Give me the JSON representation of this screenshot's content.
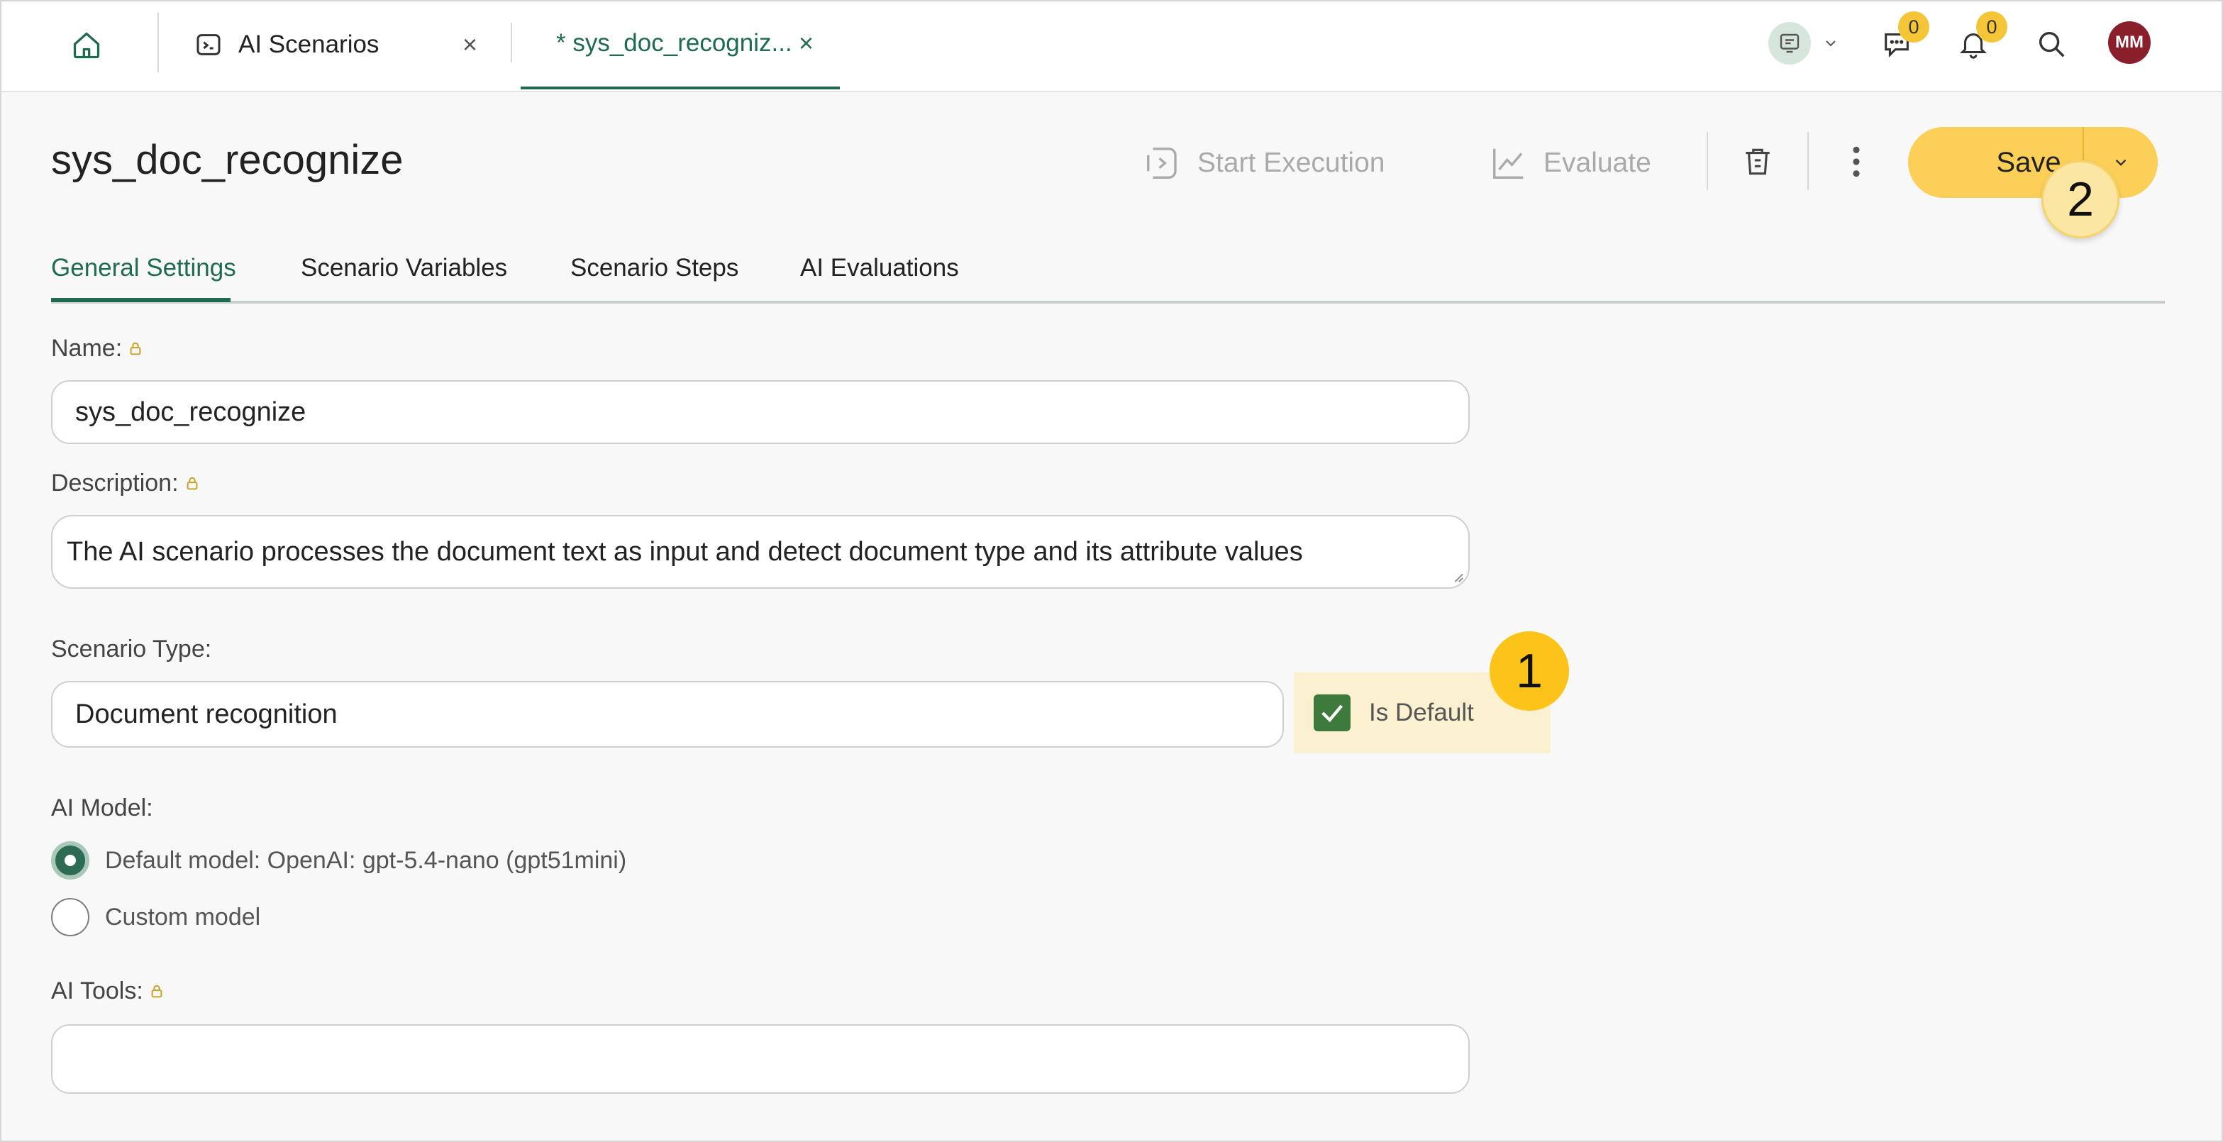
{
  "topbar": {
    "tabs": [
      {
        "label": "AI Scenarios",
        "icon": "terminal-icon"
      },
      {
        "label": "* sys_doc_recogniz...",
        "active": true
      }
    ],
    "chat_badge": "0",
    "notifications_badge": "0",
    "avatar_initials": "MM"
  },
  "header": {
    "title": "sys_doc_recognize",
    "start_execution_label": "Start Execution",
    "evaluate_label": "Evaluate",
    "save_label": "Save"
  },
  "callouts": {
    "one": "1",
    "two": "2"
  },
  "subtabs": [
    "General Settings",
    "Scenario Variables",
    "Scenario Steps",
    "AI Evaluations"
  ],
  "form": {
    "name_label": "Name:",
    "name_value": "sys_doc_recognize",
    "description_label": "Description:",
    "description_value": "The AI scenario processes the document text as input and detect document type and its attribute values",
    "scenario_type_label": "Scenario Type:",
    "scenario_type_value": "Document recognition",
    "is_default_label": "Is Default",
    "is_default_checked": true,
    "ai_model_label": "AI Model:",
    "ai_model_options": [
      "Default model: OpenAI: gpt-5.4-nano (gpt51mini)",
      "Custom model"
    ],
    "ai_model_selected": 0,
    "ai_tools_label": "AI Tools:",
    "ai_tools_value": ""
  },
  "colors": {
    "accent": "#1e6b4f",
    "save": "#fcd058",
    "callout": "#fcc419",
    "checkbox": "#3f7a3d"
  }
}
